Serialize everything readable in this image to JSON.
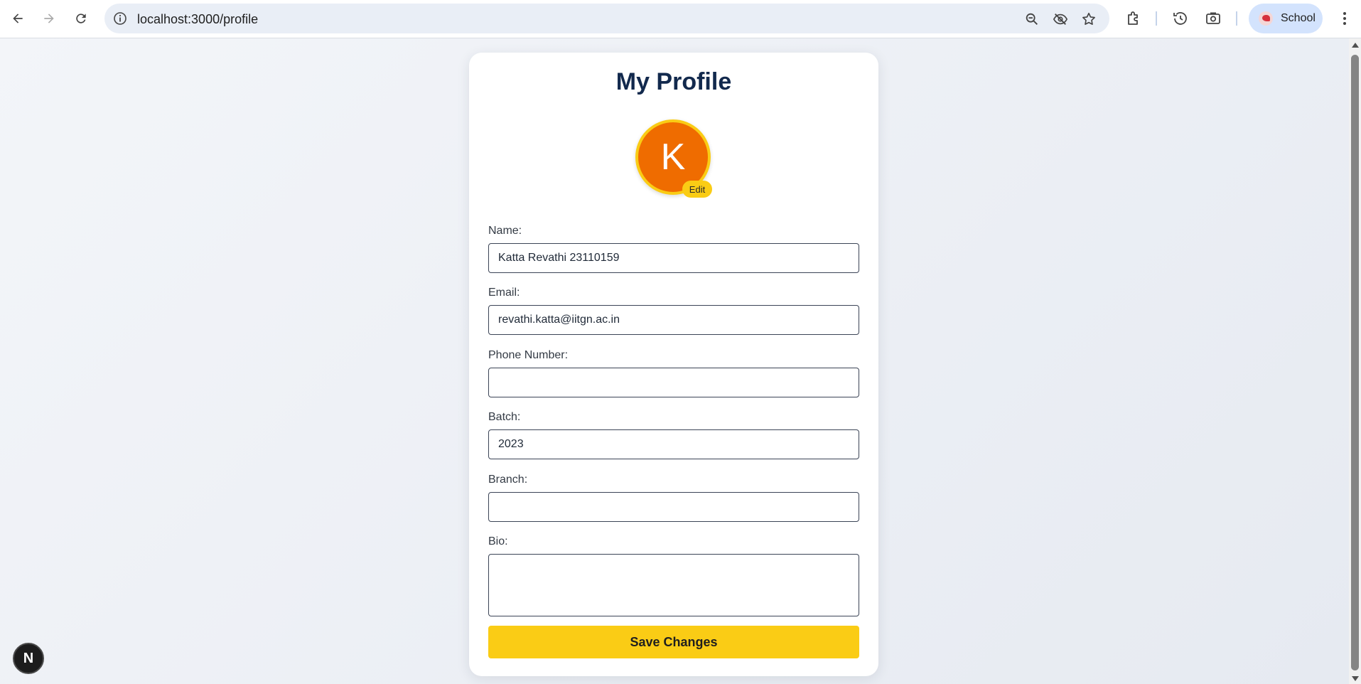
{
  "browser": {
    "url": "localhost:3000/profile",
    "profile_name": "School"
  },
  "page": {
    "title": "My Profile",
    "avatar_initial": "K",
    "avatar_edit_label": "Edit",
    "fields": {
      "name": {
        "label": "Name:",
        "value": "Katta Revathi 23110159"
      },
      "email": {
        "label": "Email:",
        "value": "revathi.katta@iitgn.ac.in"
      },
      "phone": {
        "label": "Phone Number:",
        "value": ""
      },
      "batch": {
        "label": "Batch:",
        "value": "2023"
      },
      "branch": {
        "label": "Branch:",
        "value": ""
      },
      "bio": {
        "label": "Bio:",
        "value": ""
      }
    },
    "save_label": "Save Changes",
    "dev_badge_letter": "N"
  },
  "colors": {
    "title": "#12294d",
    "avatar_bg": "#ef6c00",
    "accent": "#facc15"
  },
  "icons": [
    "back-arrow-icon",
    "forward-arrow-icon",
    "reload-icon",
    "site-info-icon",
    "zoom-icon",
    "eye-off-icon",
    "star-icon",
    "extensions-icon",
    "history-icon",
    "screenshot-icon",
    "menu-dots-icon"
  ]
}
